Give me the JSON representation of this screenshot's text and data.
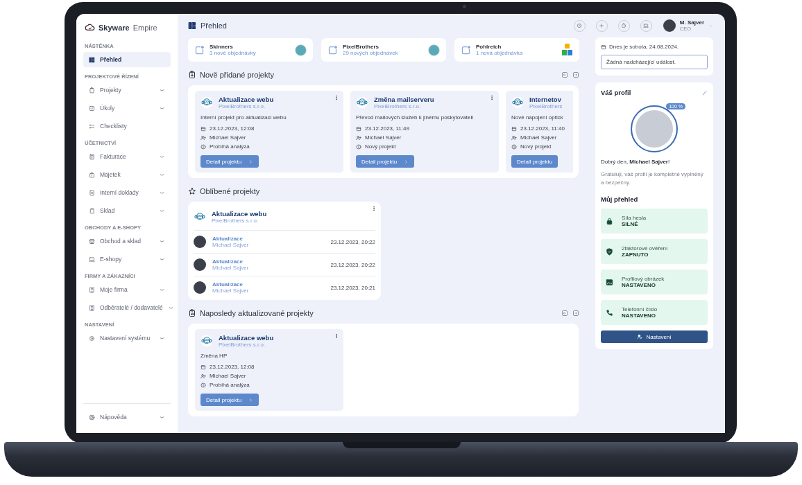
{
  "app": {
    "brand_bold": "Skyware",
    "brand_light": "Empire"
  },
  "sidebar": {
    "sections": [
      {
        "title": "NÁSTĚNKA",
        "items": [
          {
            "label": "Přehled",
            "selected": true,
            "expandable": false
          }
        ]
      },
      {
        "title": "PROJEKTOVÉ ŘÍZENÍ",
        "items": [
          {
            "label": "Projekty",
            "selected": false,
            "expandable": true
          },
          {
            "label": "Úkoly",
            "selected": false,
            "expandable": true
          },
          {
            "label": "Checklisty",
            "selected": false,
            "expandable": false
          }
        ]
      },
      {
        "title": "ÚČETNICTVÍ",
        "items": [
          {
            "label": "Fakturace",
            "selected": false,
            "expandable": true
          },
          {
            "label": "Majetek",
            "selected": false,
            "expandable": true
          },
          {
            "label": "Interní doklady",
            "selected": false,
            "expandable": true
          },
          {
            "label": "Sklad",
            "selected": false,
            "expandable": true
          }
        ]
      },
      {
        "title": "OBCHODY A E-SHOPY",
        "items": [
          {
            "label": "Obchod a sklad",
            "selected": false,
            "expandable": true
          },
          {
            "label": "E-shopy",
            "selected": false,
            "expandable": true
          }
        ]
      },
      {
        "title": "FIRMY A ZÁKAZNÍCI",
        "items": [
          {
            "label": "Moje firma",
            "selected": false,
            "expandable": true
          },
          {
            "label": "Odběratelé / dodavatelé",
            "selected": false,
            "expandable": true
          }
        ]
      },
      {
        "title": "NASTAVENÍ",
        "items": [
          {
            "label": "Nastavení systému",
            "selected": false,
            "expandable": true
          }
        ]
      }
    ],
    "footer_item": {
      "label": "Nápověda",
      "expandable": true
    }
  },
  "header": {
    "title": "Přehled",
    "user": {
      "name": "M. Sajver",
      "role": "CEO"
    }
  },
  "stats": [
    {
      "name": "Skinners",
      "subtitle": "3 nové objednávky",
      "kind": "round"
    },
    {
      "name": "PixelBrothers",
      "subtitle": "29 nových objednávek",
      "kind": "round"
    },
    {
      "name": "Pohlreich",
      "subtitle": "1 nová objednávka",
      "kind": "tiles"
    }
  ],
  "new_projects": {
    "title": "Nově přidané projekty",
    "cards": [
      {
        "title": "Aktualizace webu",
        "company": "PixelBrothers s.r.o.",
        "description": "Interní projekt pro aktualizaci webu",
        "date": "23.12.2023, 12:08",
        "owner": "Michael Sajver",
        "status": "Probíhá analýza",
        "button": "Detail projektu",
        "clipped": false
      },
      {
        "title": "Změna mailserveru",
        "company": "PixelBrothers s.r.o.",
        "description": "Převod mailových služeb k jinému poskytovateli",
        "date": "23.12.2023, 11:49",
        "owner": "Michael Sajver",
        "status": "Nový projekt",
        "button": "Detail projektu",
        "clipped": false
      },
      {
        "title": "Internetov",
        "company": "PixelBrothers",
        "description": "Nové napojení optick",
        "date": "23.12.2023, 11:40",
        "owner": "Michael Sajver",
        "status": "Nový projekt",
        "button": "Detail projektu",
        "clipped": true
      }
    ]
  },
  "favorites": {
    "title": "Oblíbené projekty",
    "project": {
      "title": "Aktualizace webu",
      "company": "PixelBrothers s.r.o."
    },
    "entries": [
      {
        "title": "Aktualizace",
        "author": "Michael Sajver",
        "time": "23.12.2023, 20:22"
      },
      {
        "title": "Aktualizace",
        "author": "Michael Sajver",
        "time": "23.12.2023, 20:22"
      },
      {
        "title": "Aktualizace",
        "author": "Michael Sajver",
        "time": "23.12.2023, 20:21"
      }
    ]
  },
  "recent": {
    "title": "Naposledy aktualizované projekty",
    "cards": [
      {
        "title": "Aktualizace webu",
        "company": "PixelBrothers s.r.o.",
        "description": "Změna HP",
        "date": "23.12.2023, 12:08",
        "owner": "Michael Sajver",
        "status": "Probíhá analýza",
        "button": "Detail projektu",
        "clipped": false
      }
    ]
  },
  "today": {
    "date": "Dnes je sobota, 24.08.2024.",
    "events": "Žádná nadcházející událost."
  },
  "profile": {
    "title": "Váš profil",
    "completion": {
      "level": 1,
      "badge": "100 %"
    },
    "greeting": "Dobrý den, **Michael Sajver**!",
    "message": "Gratuluji, váš profil je kompletně vyplněný a bezpečný.",
    "overview_title": "Můj přehled",
    "checks": [
      {
        "label": "Síla hesla",
        "value": "SILNÉ"
      },
      {
        "label": "2faktorové ověření",
        "value": "ZAPNUTO"
      },
      {
        "label": "Profilový obrázek",
        "value": "NASTAVENO"
      },
      {
        "label": "Telefonní číslo",
        "value": "NASTAVENO"
      }
    ],
    "button": "Nastavení"
  }
}
